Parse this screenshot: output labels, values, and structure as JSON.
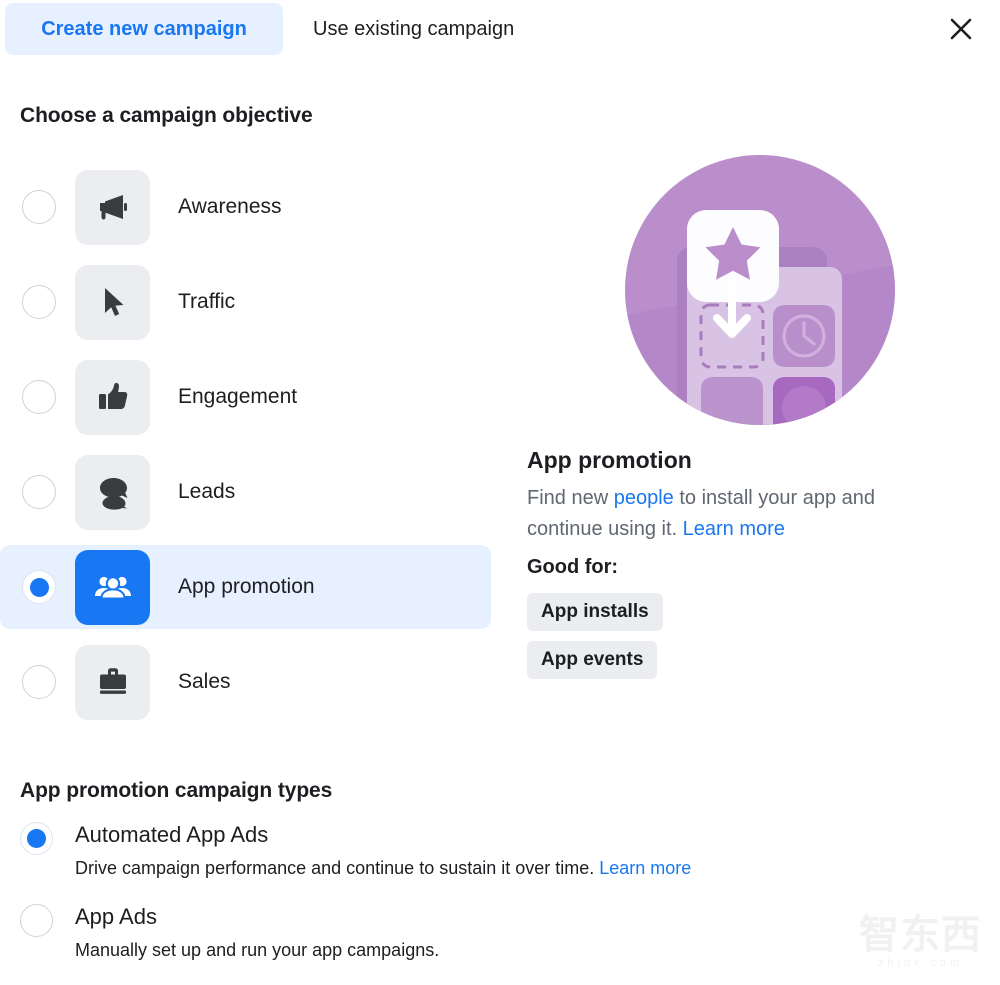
{
  "header": {
    "tabs": [
      {
        "label": "Create new campaign",
        "active": true
      },
      {
        "label": "Use existing campaign",
        "active": false
      }
    ],
    "close_icon": "close-icon"
  },
  "objective_section": {
    "title": "Choose a campaign objective",
    "options": [
      {
        "label": "Awareness",
        "icon": "megaphone-icon",
        "selected": false
      },
      {
        "label": "Traffic",
        "icon": "cursor-icon",
        "selected": false
      },
      {
        "label": "Engagement",
        "icon": "thumbs-up-icon",
        "selected": false
      },
      {
        "label": "Leads",
        "icon": "chat-bubble-icon",
        "selected": false
      },
      {
        "label": "App promotion",
        "icon": "people-group-icon",
        "selected": true
      },
      {
        "label": "Sales",
        "icon": "briefcase-icon",
        "selected": false
      }
    ]
  },
  "info_panel": {
    "illustration": "app-promotion-illustration",
    "title": "App promotion",
    "description_part1": "Find new ",
    "description_link1": "people",
    "description_part2": " to install your app and continue using it. ",
    "description_link2": "Learn more",
    "good_for_label": "Good for:",
    "chips": [
      "App installs",
      "App events"
    ]
  },
  "types_section": {
    "title": "App promotion campaign types",
    "options": [
      {
        "name": "Automated App Ads",
        "description": "Drive campaign performance and continue to sustain it over time. ",
        "link": "Learn more",
        "selected": true
      },
      {
        "name": "App Ads",
        "description": "Manually set up and run your app campaigns.",
        "link": "",
        "selected": false
      }
    ]
  },
  "watermark": {
    "main": "智东西",
    "sub": "zhidx.com"
  },
  "colors": {
    "accent": "#1877f2",
    "accent_light": "#e7f0fe",
    "tile_bg": "#ebedf0",
    "text": "#1c1e21",
    "text_muted": "#606770",
    "illustration_purple": "#b185c4"
  }
}
